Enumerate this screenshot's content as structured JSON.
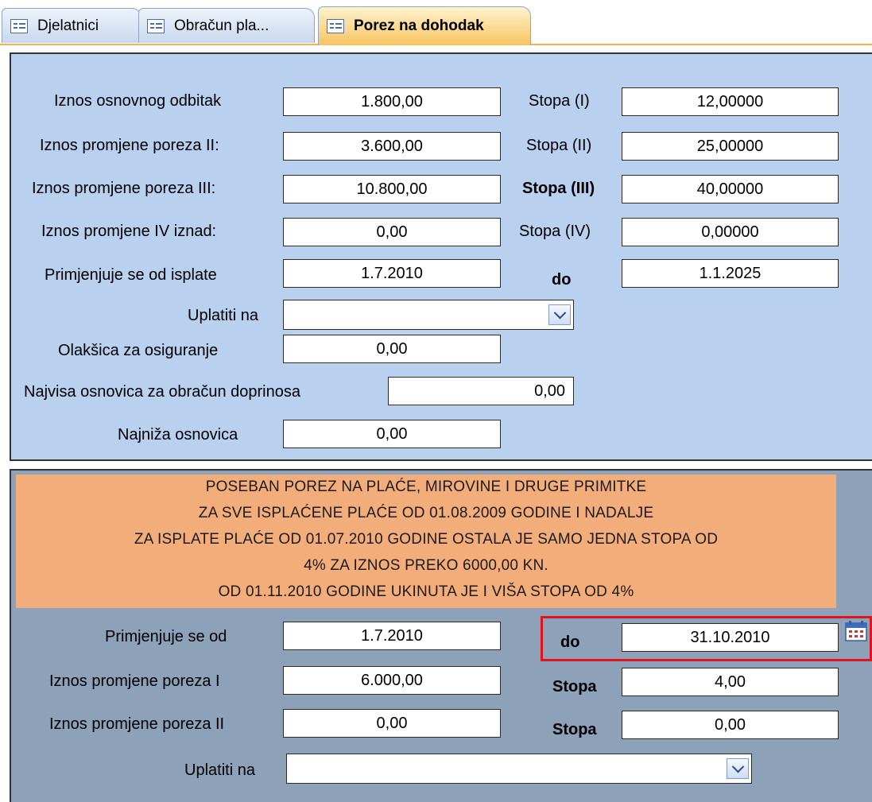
{
  "tabs": [
    {
      "label": "Djelatnici"
    },
    {
      "label": "Obračun pla..."
    },
    {
      "label": "Porez na dohodak"
    }
  ],
  "upper": {
    "rows": [
      {
        "label": "Iznos osnovnog odbitak",
        "value": "1.800,00",
        "rate_label": "Stopa (I)",
        "rate_value": "12,00000"
      },
      {
        "label": "Iznos promjene poreza II:",
        "value": "3.600,00",
        "rate_label": "Stopa (II)",
        "rate_value": "25,00000"
      },
      {
        "label": "Iznos promjene poreza III:",
        "value": "10.800,00",
        "rate_label": "Stopa (III)",
        "rate_value": "40,00000"
      },
      {
        "label": "Iznos promjene IV iznad:",
        "value": "0,00",
        "rate_label": "Stopa (IV)",
        "rate_value": "0,00000"
      }
    ],
    "applies_from_label": "Primjenjuje se od isplate",
    "applies_from_value": "1.7.2010",
    "applies_to_label": "do",
    "applies_to_value": "1.1.2025",
    "pay_to_label": "Uplatiti na",
    "pay_to_value": "",
    "insurance_relief_label": "Olakšica za osiguranje",
    "insurance_relief_value": "0,00",
    "max_base_label": "Najvisa osnovica za obračun doprinosa",
    "max_base_value": "0,00",
    "min_base_label": "Najniža osnovica",
    "min_base_value": "0,00"
  },
  "notice": {
    "lines": [
      "POSEBAN POREZ NA PLAĆE, MIROVINE I DRUGE PRIMITKE",
      "ZA SVE ISPLAĆENE PLAĆE OD 01.08.2009  GODINE I NADALJE",
      "ZA ISPLATE PLAĆE OD 01.07.2010 GODINE OSTALA JE SAMO JEDNA STOPA OD",
      "4% ZA IZNOS PREKO 6000,00 KN.",
      "OD 01.11.2010 GODINE UKINUTA JE I VIŠA STOPA OD 4%"
    ]
  },
  "lower": {
    "applies_from_label": "Primjenjuje se od",
    "applies_from_value": "1.7.2010",
    "applies_to_label": "do",
    "applies_to_value": "31.10.2010",
    "change1_label": "Iznos promjene poreza I",
    "change1_value": "6.000,00",
    "rate1_label": "Stopa",
    "rate1_value": "4,00",
    "change2_label": "Iznos promjene poreza II",
    "change2_value": "0,00",
    "rate2_label": "Stopa",
    "rate2_value": "0,00",
    "pay_to_label": "Uplatiti na",
    "pay_to_value": ""
  },
  "icons": {
    "tab_icon": "form-icon",
    "dropdown_icon": "chevron-down-icon",
    "calendar_icon": "calendar-icon"
  },
  "colors": {
    "upper_bg": "#b9d0ef",
    "lower_bg": "#8da1b8",
    "notice_bg": "#f2ad7b",
    "active_tab": "#f7c45f",
    "highlight": "#e0141c"
  }
}
